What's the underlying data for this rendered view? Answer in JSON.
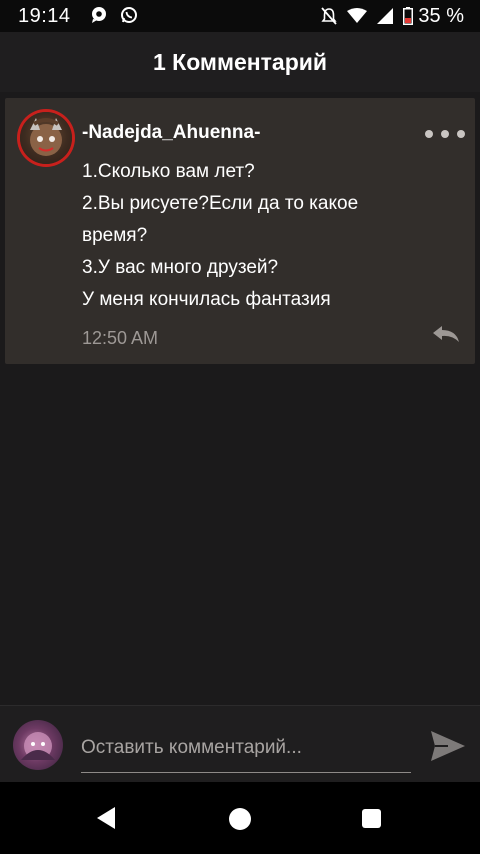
{
  "status_bar": {
    "time": "19:14",
    "battery_percent": "35 %",
    "left_icons": [
      "chat-bubble-icon",
      "whatsapp-icon"
    ],
    "right_icons": [
      "mute-notifications-icon",
      "wifi-icon",
      "signal-icon",
      "battery-low-icon"
    ]
  },
  "header": {
    "title": "1 Комментарий"
  },
  "comment": {
    "author": "-Nadejda_Ahuenna-",
    "lines": [
      "1.Сколько вам лет?",
      "2.Вы рисуете?Если да то какое",
      "время?",
      "3.У вас много друзей?",
      "У меня кончилась фантазия"
    ],
    "time": "12:50 AM",
    "avatar_ring_color": "#c8201c"
  },
  "input": {
    "placeholder": "Оставить комментарий..."
  },
  "colors": {
    "background": "#1b1a1b",
    "card": "#322e2b",
    "secondary_text": "#9d9895"
  }
}
